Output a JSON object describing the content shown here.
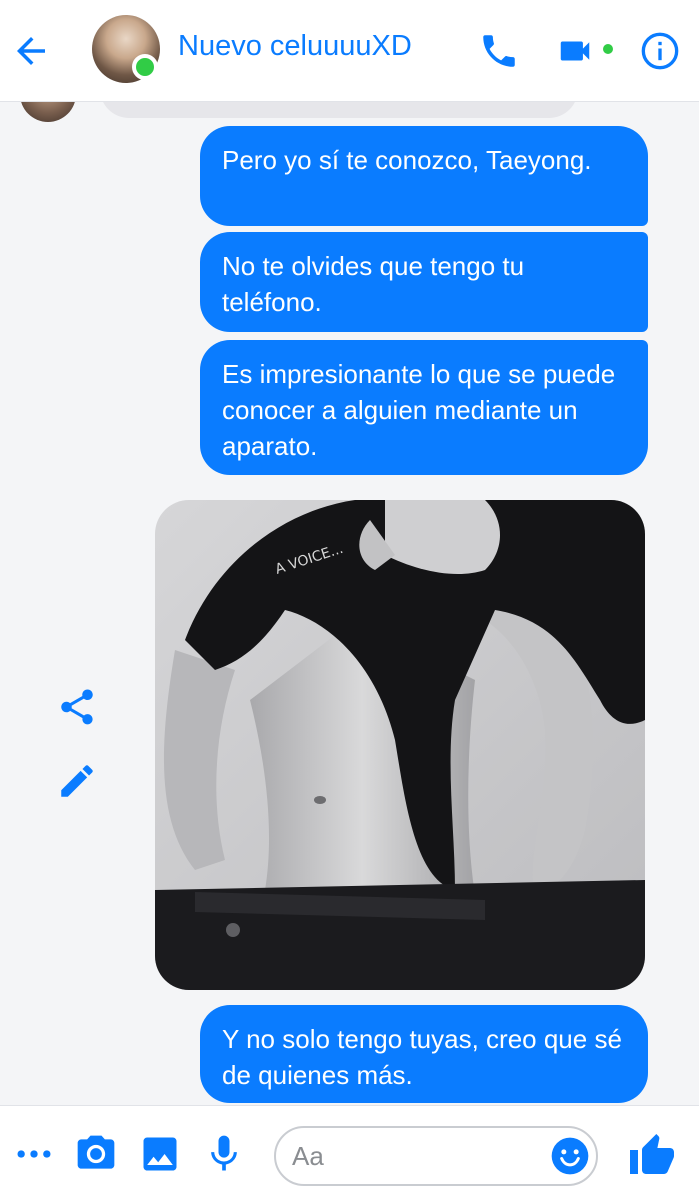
{
  "header": {
    "contact_name": "Nuevo celuuuuXD",
    "online": true,
    "icons": {
      "back": "back-arrow-icon",
      "call": "phone-icon",
      "video": "video-camera-icon",
      "info": "info-icon"
    }
  },
  "messages": [
    {
      "direction": "sent",
      "type": "text",
      "text": "Pero yo sí te conozco, Taeyong."
    },
    {
      "direction": "sent",
      "type": "text",
      "text": "No te olvides que tengo tu teléfono."
    },
    {
      "direction": "sent",
      "type": "text",
      "text": "Es impresionante lo que se puede conocer a alguien mediante un aparato."
    },
    {
      "direction": "sent",
      "type": "image",
      "caption_visible": "A VOICE..."
    },
    {
      "direction": "sent",
      "type": "text",
      "text": "Y no solo tengo tuyas, creo que sé de quienes más."
    }
  ],
  "image_actions": {
    "share_icon": "share-icon",
    "edit_icon": "pencil-icon"
  },
  "composer": {
    "placeholder": "Aa",
    "icons": [
      "more-dots-icon",
      "camera-icon",
      "image-icon",
      "microphone-icon",
      "emoji-icon",
      "thumbs-up-icon"
    ]
  },
  "colors": {
    "accent": "#0a7cff",
    "online": "#31cc46",
    "background": "#f4f5f7",
    "received_bubble": "#e6e6ea"
  }
}
